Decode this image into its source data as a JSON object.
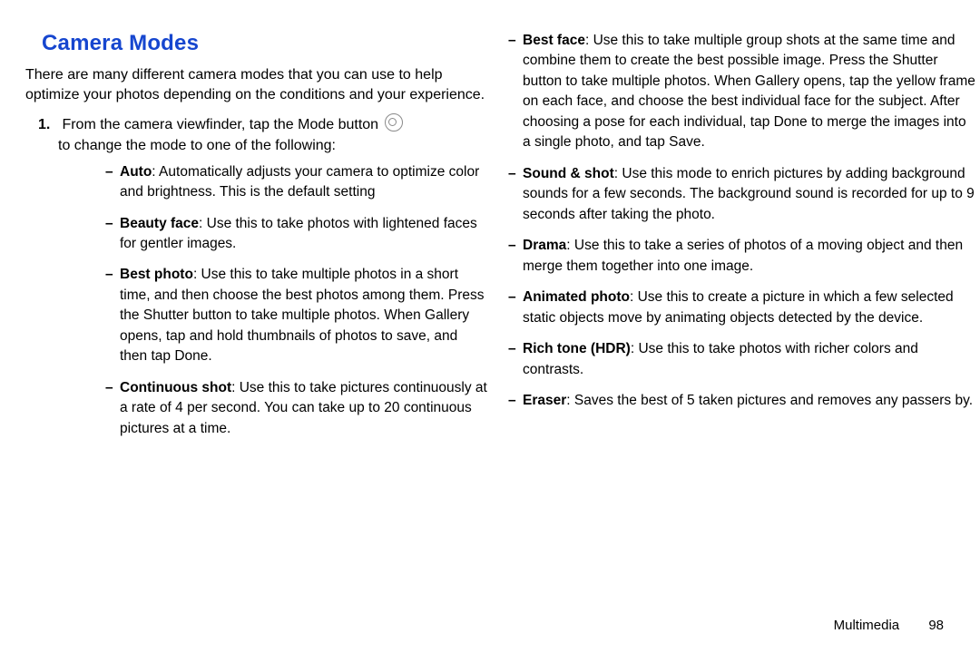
{
  "heading": "Camera Modes",
  "intro": "There are many different camera modes that you can use to help optimize your photos depending on the conditions and your experience.",
  "step1_a": "From the camera viewfinder, tap the Mode button",
  "step1_b": "to change the mode to one of the following:",
  "left_modes": [
    {
      "name": "Auto",
      "text": ": Automatically adjusts your camera to optimize color and brightness. This is the default setting"
    },
    {
      "name": "Beauty face",
      "text": ": Use this to take photos with lightened faces for gentler images."
    },
    {
      "name": "Best photo",
      "text": ": Use this to take multiple photos in a short time, and then choose the best photos among them. Press the Shutter button to take multiple photos. When Gallery opens, tap and hold thumbnails of photos to save, and then tap Done."
    },
    {
      "name": "Continuous shot",
      "text": ": Use this to take pictures continuously at a rate of 4 per second. You can take up to 20 continuous pictures at a time."
    }
  ],
  "right_modes": [
    {
      "name": "Best face",
      "text": ": Use this to take multiple group shots at the same time and combine them to create the best possible image. Press the Shutter button to take multiple photos. When Gallery opens, tap the yellow frame on each face, and choose the best individual face for the subject. After choosing a pose for each individual, tap Done to merge the images into a single photo, and tap Save."
    },
    {
      "name": "Sound & shot",
      "text": ": Use this mode to enrich pictures by adding background sounds for a few seconds. The background sound is recorded for up to 9 seconds after taking the photo."
    },
    {
      "name": "Drama",
      "text": ": Use this to take a series of photos of a moving object and then merge them together into one image."
    },
    {
      "name": "Animated photo",
      "text": ": Use this to create a picture in which a few selected static objects move by animating objects detected by the device."
    },
    {
      "name": "Rich tone (HDR)",
      "text": ": Use this to take photos with richer colors and contrasts."
    },
    {
      "name": "Eraser",
      "text": ": Saves the best of 5 taken pictures and removes any passers by."
    }
  ],
  "footer_section": "Multimedia",
  "footer_page": "98"
}
